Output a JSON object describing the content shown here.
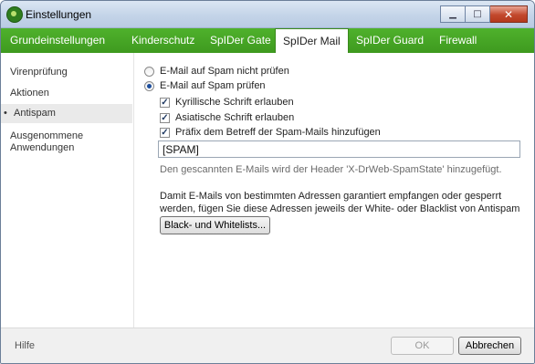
{
  "window": {
    "title": "Einstellungen"
  },
  "tabs": [
    {
      "label": "Grundeinstellungen"
    },
    {
      "label": "Kinderschutz"
    },
    {
      "label": "SpIDer Gate"
    },
    {
      "label": "SpIDer Mail"
    },
    {
      "label": "SpIDer Guard"
    },
    {
      "label": "Firewall"
    }
  ],
  "sidebar": {
    "items": [
      {
        "label": "Virenprüfung"
      },
      {
        "label": "Aktionen"
      },
      {
        "label": "Antispam"
      },
      {
        "label": "Ausgenommene Anwendungen"
      }
    ]
  },
  "spam": {
    "radio_off_label": "E-Mail auf Spam nicht prüfen",
    "radio_on_label": "E-Mail auf Spam prüfen",
    "cyrillic_label": "Kyrillische Schrift erlauben",
    "asian_label": "Asiatische Schrift erlauben",
    "prefix_label": "Präfix dem Betreff der Spam-Mails hinzufügen",
    "prefix_value": "[SPAM]",
    "header_hint": "Den gescannten E-Mails wird der Header 'X-DrWeb-SpamState' hinzugefügt.",
    "info_text": "Damit E-Mails von bestimmten Adressen garantiert empfangen oder gesperrt werden, fügen Sie diese Adressen jeweils der White- oder Blacklist von Antispam hinzu.",
    "lists_button": "Black- und Whitelists..."
  },
  "footer": {
    "help_label": "Hilfe",
    "ok_label": "OK",
    "cancel_label": "Abbrechen"
  }
}
